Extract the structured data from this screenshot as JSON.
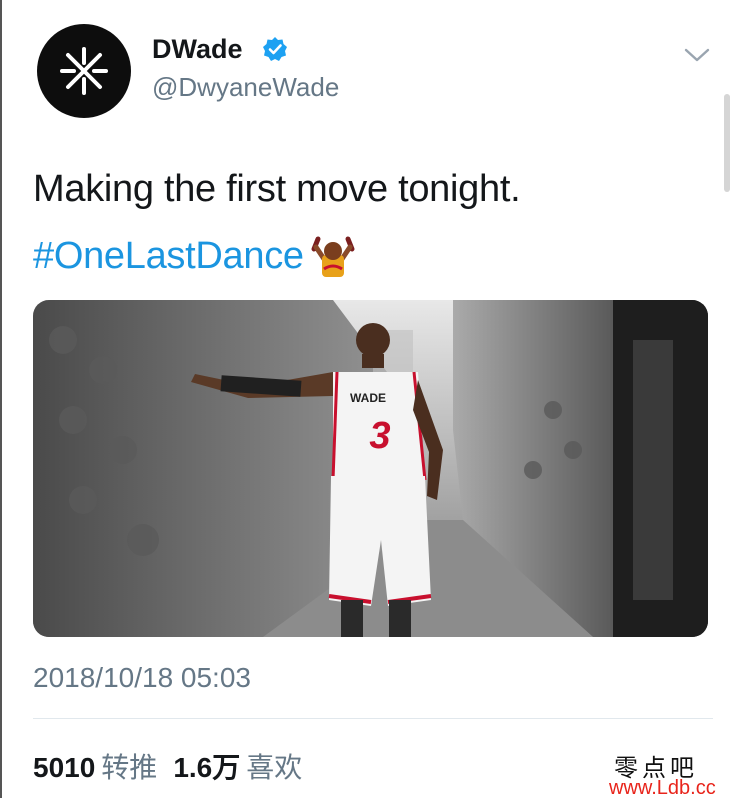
{
  "profile": {
    "display_name": "DWade",
    "handle": "@DwyaneWade",
    "verified_icon": "verified-badge-icon",
    "avatar_icon": "wade-logo-icon"
  },
  "tweet": {
    "text": "Making the first move tonight.",
    "hashtag": "#OneLastDance",
    "hashtag_emoji": "wade-dance-emoji",
    "timestamp": "2018/10/18 05:03",
    "jersey_name": "WADE",
    "jersey_number": "3"
  },
  "stats": {
    "retweets_count": "5010",
    "retweets_label": "转推",
    "likes_count": "1.6万",
    "likes_label": "喜欢"
  },
  "watermark": {
    "site_name": "零点吧",
    "url": "www.Ldb.cc"
  },
  "colors": {
    "link": "#1b95e0",
    "secondary_text": "#657786",
    "verified": "#1da1f2",
    "jersey_red": "#c8102e"
  }
}
